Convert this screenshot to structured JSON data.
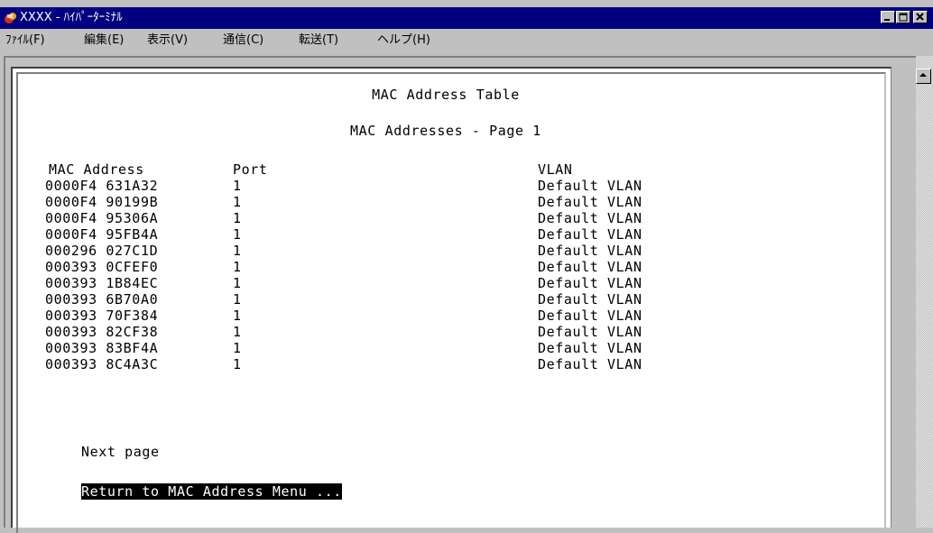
{
  "window": {
    "title": "XXXX - ﾊｲﾊﾟｰﾀｰﾐﾅﾙ",
    "title_bar_color": "#000080"
  },
  "menu": {
    "items": [
      {
        "label": "ﾌｧｲﾙ(F)"
      },
      {
        "label": "編集(E)"
      },
      {
        "label": "表示(V)"
      },
      {
        "label": "通信(C)"
      },
      {
        "label": "転送(T)"
      },
      {
        "label": "ヘルプ(H)"
      }
    ]
  },
  "screen": {
    "title": "MAC Address Table",
    "subtitle": "MAC Addresses - Page 1",
    "headers": {
      "mac": "MAC Address",
      "port": "Port",
      "vlan": "VLAN"
    },
    "rows": [
      {
        "mac": "0000F4 631A32",
        "port": "1",
        "vlan": "Default VLAN"
      },
      {
        "mac": "0000F4 90199B",
        "port": "1",
        "vlan": "Default VLAN"
      },
      {
        "mac": "0000F4 95306A",
        "port": "1",
        "vlan": "Default VLAN"
      },
      {
        "mac": "0000F4 95FB4A",
        "port": "1",
        "vlan": "Default VLAN"
      },
      {
        "mac": "000296 027C1D",
        "port": "1",
        "vlan": "Default VLAN"
      },
      {
        "mac": "000393 0CFEF0",
        "port": "1",
        "vlan": "Default VLAN"
      },
      {
        "mac": "000393 1B84EC",
        "port": "1",
        "vlan": "Default VLAN"
      },
      {
        "mac": "000393 6B70A0",
        "port": "1",
        "vlan": "Default VLAN"
      },
      {
        "mac": "000393 70F384",
        "port": "1",
        "vlan": "Default VLAN"
      },
      {
        "mac": "000393 82CF38",
        "port": "1",
        "vlan": "Default VLAN"
      },
      {
        "mac": "000393 83BF4A",
        "port": "1",
        "vlan": "Default VLAN"
      },
      {
        "mac": "000393 8C4A3C",
        "port": "1",
        "vlan": "Default VLAN"
      }
    ],
    "next_page": "Next page",
    "return_menu": "Return to MAC Address Menu ..."
  }
}
